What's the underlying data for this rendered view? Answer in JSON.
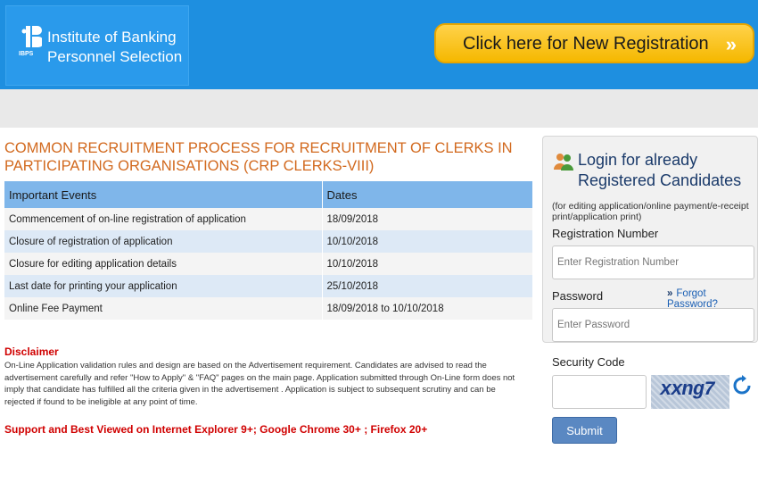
{
  "header": {
    "logo_abbr": "IBPS",
    "org_line1": "Institute of Banking",
    "org_line2": "Personnel Selection",
    "registration_button": "Click here for New Registration",
    "registration_arrow": "»"
  },
  "main": {
    "title_line1": "COMMON RECRUITMENT PROCESS FOR RECRUITMENT OF CLERKS IN",
    "title_line2": "PARTICIPATING ORGANISATIONS (CRP CLERKS-VIII)",
    "table": {
      "headers": [
        "Important Events",
        "Dates"
      ],
      "rows": [
        [
          "Commencement of on-line registration of application",
          "18/09/2018"
        ],
        [
          "Closure of registration of application",
          "10/10/2018"
        ],
        [
          "Closure for editing application details",
          "10/10/2018"
        ],
        [
          "Last date for printing your application",
          "25/10/2018"
        ],
        [
          "Online Fee Payment",
          "18/09/2018 to 10/10/2018"
        ]
      ]
    },
    "disclaimer_title": "Disclaimer",
    "disclaimer_body": "On-Line Application validation rules and design are based on the Advertisement requirement. Candidates are advised to read the advertisement carefully and refer \"How to Apply\" & \"FAQ\" pages on the main page. Application submitted through On-Line form does not imply that candidate has fulfilled all the criteria given in the advertisement . Application is subject to subsequent scrutiny and can be rejected if found to be ineligible at any point of time.",
    "support_text": "Support and Best Viewed on Internet Explorer 9+; Google Chrome 30+ ; Firefox 20+"
  },
  "login": {
    "title_line1": "Login for already",
    "title_line2": "Registered Candidates",
    "note": "(for editing application/online payment/e-receipt print/application print)",
    "registration_label": "Registration Number",
    "registration_placeholder": "Enter Registration Number",
    "password_label": "Password",
    "password_placeholder": "Enter Password",
    "forgot_arrow": "»",
    "forgot_link": "Forgot Password?",
    "security_label": "Security Code",
    "captcha_text": "xxng7",
    "submit_label": "Submit"
  },
  "colors": {
    "header_blue": "#1e8fe0",
    "registration_yellow": "#f5b800",
    "title_orange": "#d2691e",
    "table_header_blue": "#7fb6ea",
    "disclaimer_red": "#d00000",
    "submit_blue": "#5a88c2"
  },
  "icons": {
    "logo": "ibps-logo-icon",
    "login": "users-icon",
    "refresh": "refresh-icon"
  }
}
